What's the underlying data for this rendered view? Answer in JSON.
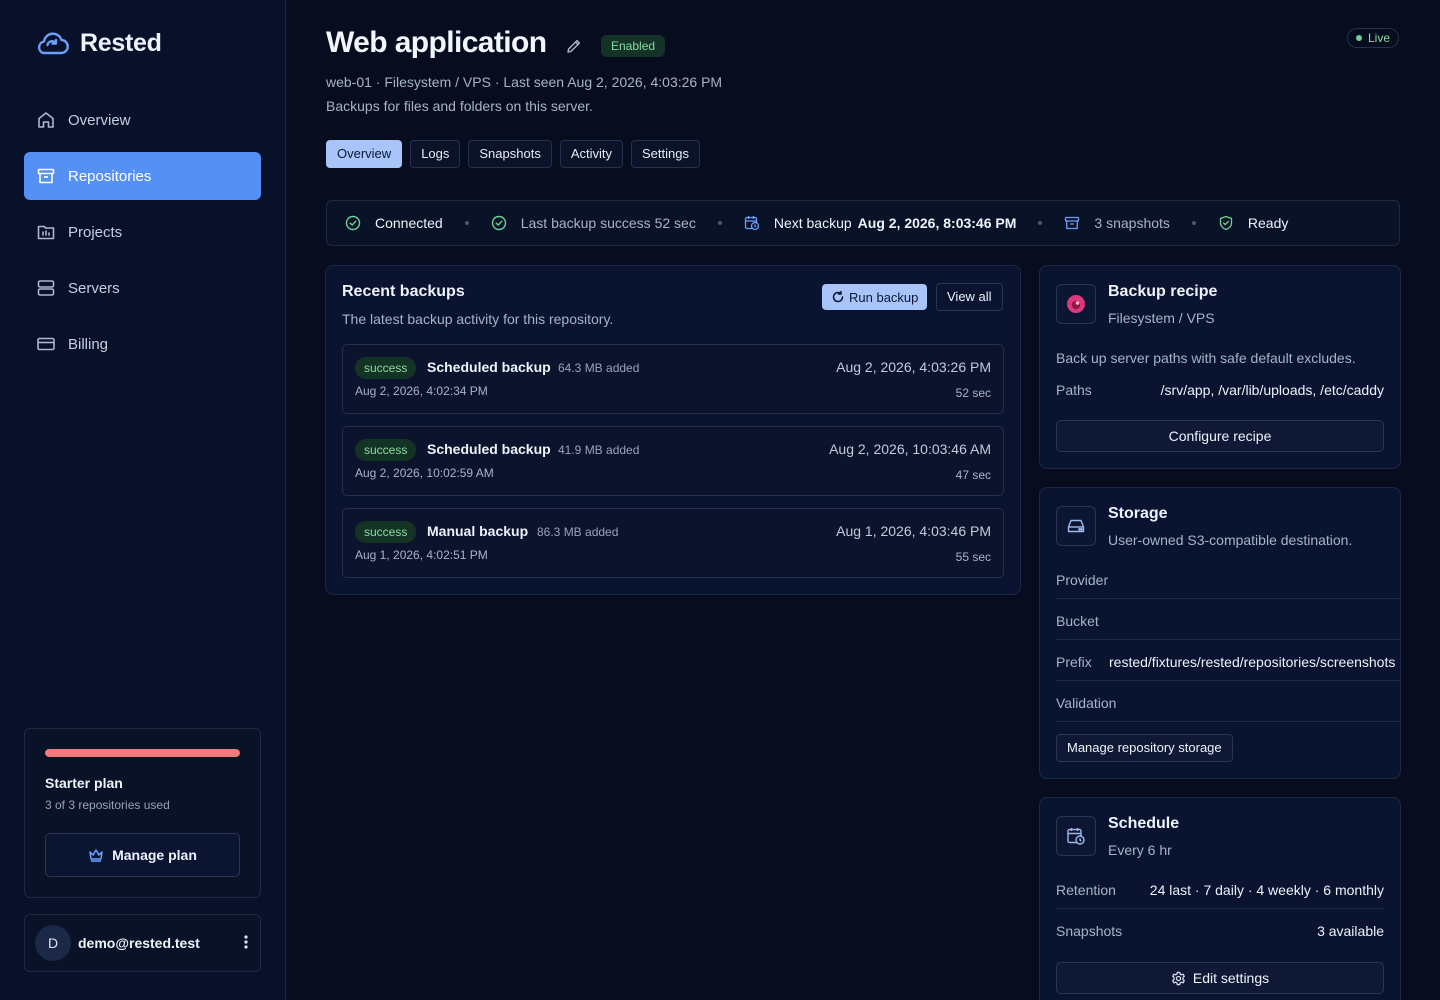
{
  "brand": {
    "name": "Rested",
    "logo_icon": "cloud-sync-icon",
    "accent": "#5590f4"
  },
  "nav": [
    {
      "label": "Overview",
      "icon": "home-icon",
      "active": false
    },
    {
      "label": "Repositories",
      "icon": "archive-icon",
      "active": true
    },
    {
      "label": "Projects",
      "icon": "folder-chart-icon",
      "active": false
    },
    {
      "label": "Servers",
      "icon": "server-icon",
      "active": false
    },
    {
      "label": "Billing",
      "icon": "credit-card-icon",
      "active": false
    }
  ],
  "plan": {
    "title": "Starter plan",
    "usage": "3 of 3 repositories used",
    "usage_fraction": 1.0,
    "bar_color": "#f07b7b",
    "button": "Manage plan",
    "button_icon": "crown-icon"
  },
  "user": {
    "initial": "D",
    "email": "demo@rested.test",
    "menu_icon": "kebab-icon"
  },
  "header": {
    "title": "Web application",
    "status_badge": "Enabled",
    "live": "Live",
    "meta": "web-01 · Filesystem / VPS · Last seen Aug 2, 2026, 4:03:26 PM",
    "description": "Backups for files and folders on this server."
  },
  "tabs": [
    {
      "label": "Overview",
      "active": true
    },
    {
      "label": "Logs",
      "active": false
    },
    {
      "label": "Snapshots",
      "active": false
    },
    {
      "label": "Activity",
      "active": false
    },
    {
      "label": "Settings",
      "active": false
    }
  ],
  "status_strip": {
    "connected": "Connected",
    "last_backup": "Last backup success 52 sec",
    "next_label": "Next backup",
    "next_value": "Aug 2, 2026, 8:03:46 PM",
    "snapshots": "3 snapshots",
    "ready": "Ready"
  },
  "recent": {
    "title": "Recent backups",
    "subtitle": "The latest backup activity for this repository.",
    "run_button": "Run backup",
    "view_all": "View all",
    "items": [
      {
        "status": "success",
        "name": "Scheduled backup",
        "added": "64.3 MB added",
        "started": "Aug 2, 2026, 4:02:34 PM",
        "finished": "Aug 2, 2026, 4:03:26 PM",
        "duration": "52 sec"
      },
      {
        "status": "success",
        "name": "Scheduled backup",
        "added": "41.9 MB added",
        "started": "Aug 2, 2026, 10:02:59 AM",
        "finished": "Aug 2, 2026, 10:03:46 AM",
        "duration": "47 sec"
      },
      {
        "status": "success",
        "name": "Manual backup",
        "added": "86.3 MB added",
        "started": "Aug 1, 2026, 4:02:51 PM",
        "finished": "Aug 1, 2026, 4:03:46 PM",
        "duration": "55 sec"
      }
    ]
  },
  "recipe": {
    "title": "Backup recipe",
    "subtitle": "Filesystem / VPS",
    "description": "Back up server paths with safe default excludes.",
    "paths_label": "Paths",
    "paths_value": "/srv/app, /var/lib/uploads, /etc/caddy",
    "button": "Configure recipe"
  },
  "storage": {
    "title": "Storage",
    "subtitle": "User-owned S3-compatible destination.",
    "provider_label": "Provider",
    "bucket_label": "Bucket",
    "prefix_label": "Prefix",
    "prefix_value": "rested/fixtures/rested/repositories/screenshots",
    "validation_label": "Validation",
    "button": "Manage repository storage"
  },
  "schedule": {
    "title": "Schedule",
    "subtitle": "Every 6 hr",
    "retention_label": "Retention",
    "retention_value": "24 last · 7 daily · 4 weekly · 6 monthly",
    "snapshots_label": "Snapshots",
    "snapshots_value": "3 available",
    "button": "Edit settings"
  }
}
